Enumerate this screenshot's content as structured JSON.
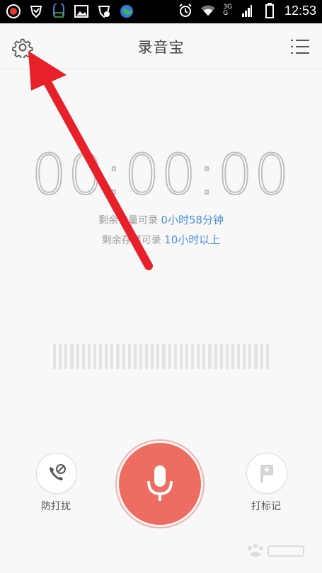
{
  "status_bar": {
    "time": "12:53",
    "network_top": "3G",
    "network_bottom": "G"
  },
  "app_bar": {
    "title": "录音宝",
    "settings_icon": "gear-icon",
    "menu_icon": "list-menu-icon"
  },
  "timer": {
    "display": "00:00:00"
  },
  "info": {
    "battery_prefix": "剩余电量可录",
    "battery_value": "0小时58分钟",
    "storage_prefix": "剩余存储可录",
    "storage_value": "10小时以上"
  },
  "controls": {
    "dnd_label": "防打扰",
    "mark_label": "打标记",
    "record_icon": "microphone-icon",
    "dnd_icon": "phone-block-icon",
    "mark_icon": "flag-add-icon"
  },
  "colors": {
    "record": "#ee6d62",
    "highlight": "#4a90d9",
    "annotation_arrow": "#e8202a"
  }
}
